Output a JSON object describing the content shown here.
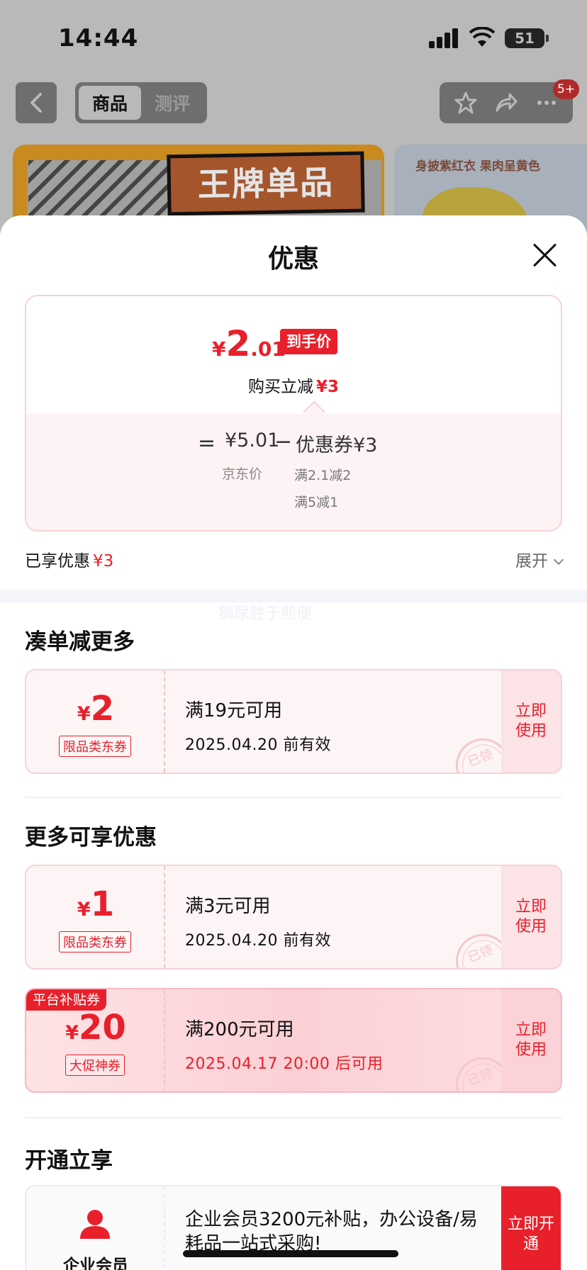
{
  "status": {
    "time": "14:44",
    "battery": "51"
  },
  "nav": {
    "tabs": [
      {
        "label": "商品"
      },
      {
        "label": "测评"
      }
    ],
    "badge": "5+"
  },
  "background": {
    "hero_text": "王牌单品",
    "side_text": "身披紫红衣 果肉呈黄色"
  },
  "sheet": {
    "title": "优惠",
    "price": {
      "currency": "¥",
      "integer": "2",
      "decimal": ".01",
      "tag": "到手价",
      "instant_label": "购买立减",
      "instant_value": "¥3",
      "eq": "=",
      "jd_price": "¥5.01",
      "minus": "−",
      "coupon_label": "优惠券¥3",
      "jd_label": "京东价",
      "rule1": "满2.1减2",
      "rule2": "满5减1"
    },
    "enjoy": {
      "label": "已享优惠",
      "value": "¥3",
      "expand": "展开"
    },
    "watermark": "狮尿胜于熊便",
    "sections": {
      "combine": "凑单减更多",
      "more": "更多可享优惠",
      "open": "开通立享"
    },
    "coupons": [
      {
        "currency": "¥",
        "amount": "2",
        "type": "限品类东券",
        "condition": "满19元可用",
        "date": "2025.04.20 前有效",
        "button": "立即使用",
        "stamp": "已领"
      },
      {
        "currency": "¥",
        "amount": "1",
        "type": "限品类东券",
        "condition": "满3元可用",
        "date": "2025.04.20 前有效",
        "button": "立即使用",
        "stamp": "已领"
      },
      {
        "currency": "¥",
        "amount": "20",
        "type": "大促神券",
        "platform": "平台补贴券",
        "condition": "满200元可用",
        "date": "2025.04.17 20:00 后可用",
        "button": "立即使用",
        "stamp": "已领"
      }
    ],
    "member": {
      "name": "企业会员",
      "description": "企业会员3200元补贴，办公设备/易耗品一站式采购!",
      "button": "立即开通"
    }
  },
  "colors": {
    "accent": "#e8202b",
    "coupon_bg": "#fdf4f5",
    "border": "#f7d2d6"
  }
}
